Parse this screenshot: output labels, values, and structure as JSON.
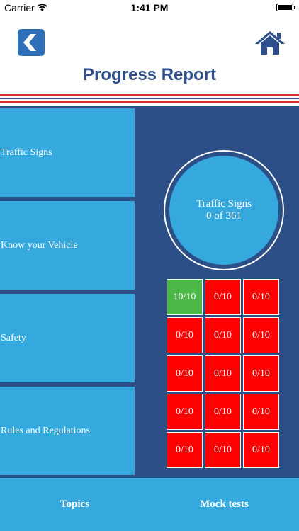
{
  "status_bar": {
    "carrier": "Carrier",
    "time": "1:41 PM",
    "battery_level": 1.0
  },
  "header": {
    "title": "Progress Report",
    "back_icon": "chevron-left-icon",
    "home_icon": "home-icon"
  },
  "colors": {
    "brand_dark": "#2d4f87",
    "brand_light": "#35a8de",
    "accent_red": "#d32f2f",
    "fail_red": "#ff0000",
    "pass_green": "#4cb848"
  },
  "topics": [
    {
      "label": "Traffic Signs"
    },
    {
      "label": "Know your Vehicle"
    },
    {
      "label": "Safety"
    },
    {
      "label": "Rules and Regulations"
    }
  ],
  "summary": {
    "title": "Traffic Signs",
    "progress": "0 of 361"
  },
  "tests": [
    {
      "score": "10/10",
      "passed": true
    },
    {
      "score": "0/10",
      "passed": false
    },
    {
      "score": "0/10",
      "passed": false
    },
    {
      "score": "0/10",
      "passed": false
    },
    {
      "score": "0/10",
      "passed": false
    },
    {
      "score": "0/10",
      "passed": false
    },
    {
      "score": "0/10",
      "passed": false
    },
    {
      "score": "0/10",
      "passed": false
    },
    {
      "score": "0/10",
      "passed": false
    },
    {
      "score": "0/10",
      "passed": false
    },
    {
      "score": "0/10",
      "passed": false
    },
    {
      "score": "0/10",
      "passed": false
    },
    {
      "score": "0/10",
      "passed": false
    },
    {
      "score": "0/10",
      "passed": false
    },
    {
      "score": "0/10",
      "passed": false
    }
  ],
  "tabs": [
    {
      "label": "Topics"
    },
    {
      "label": "Mock tests"
    }
  ]
}
